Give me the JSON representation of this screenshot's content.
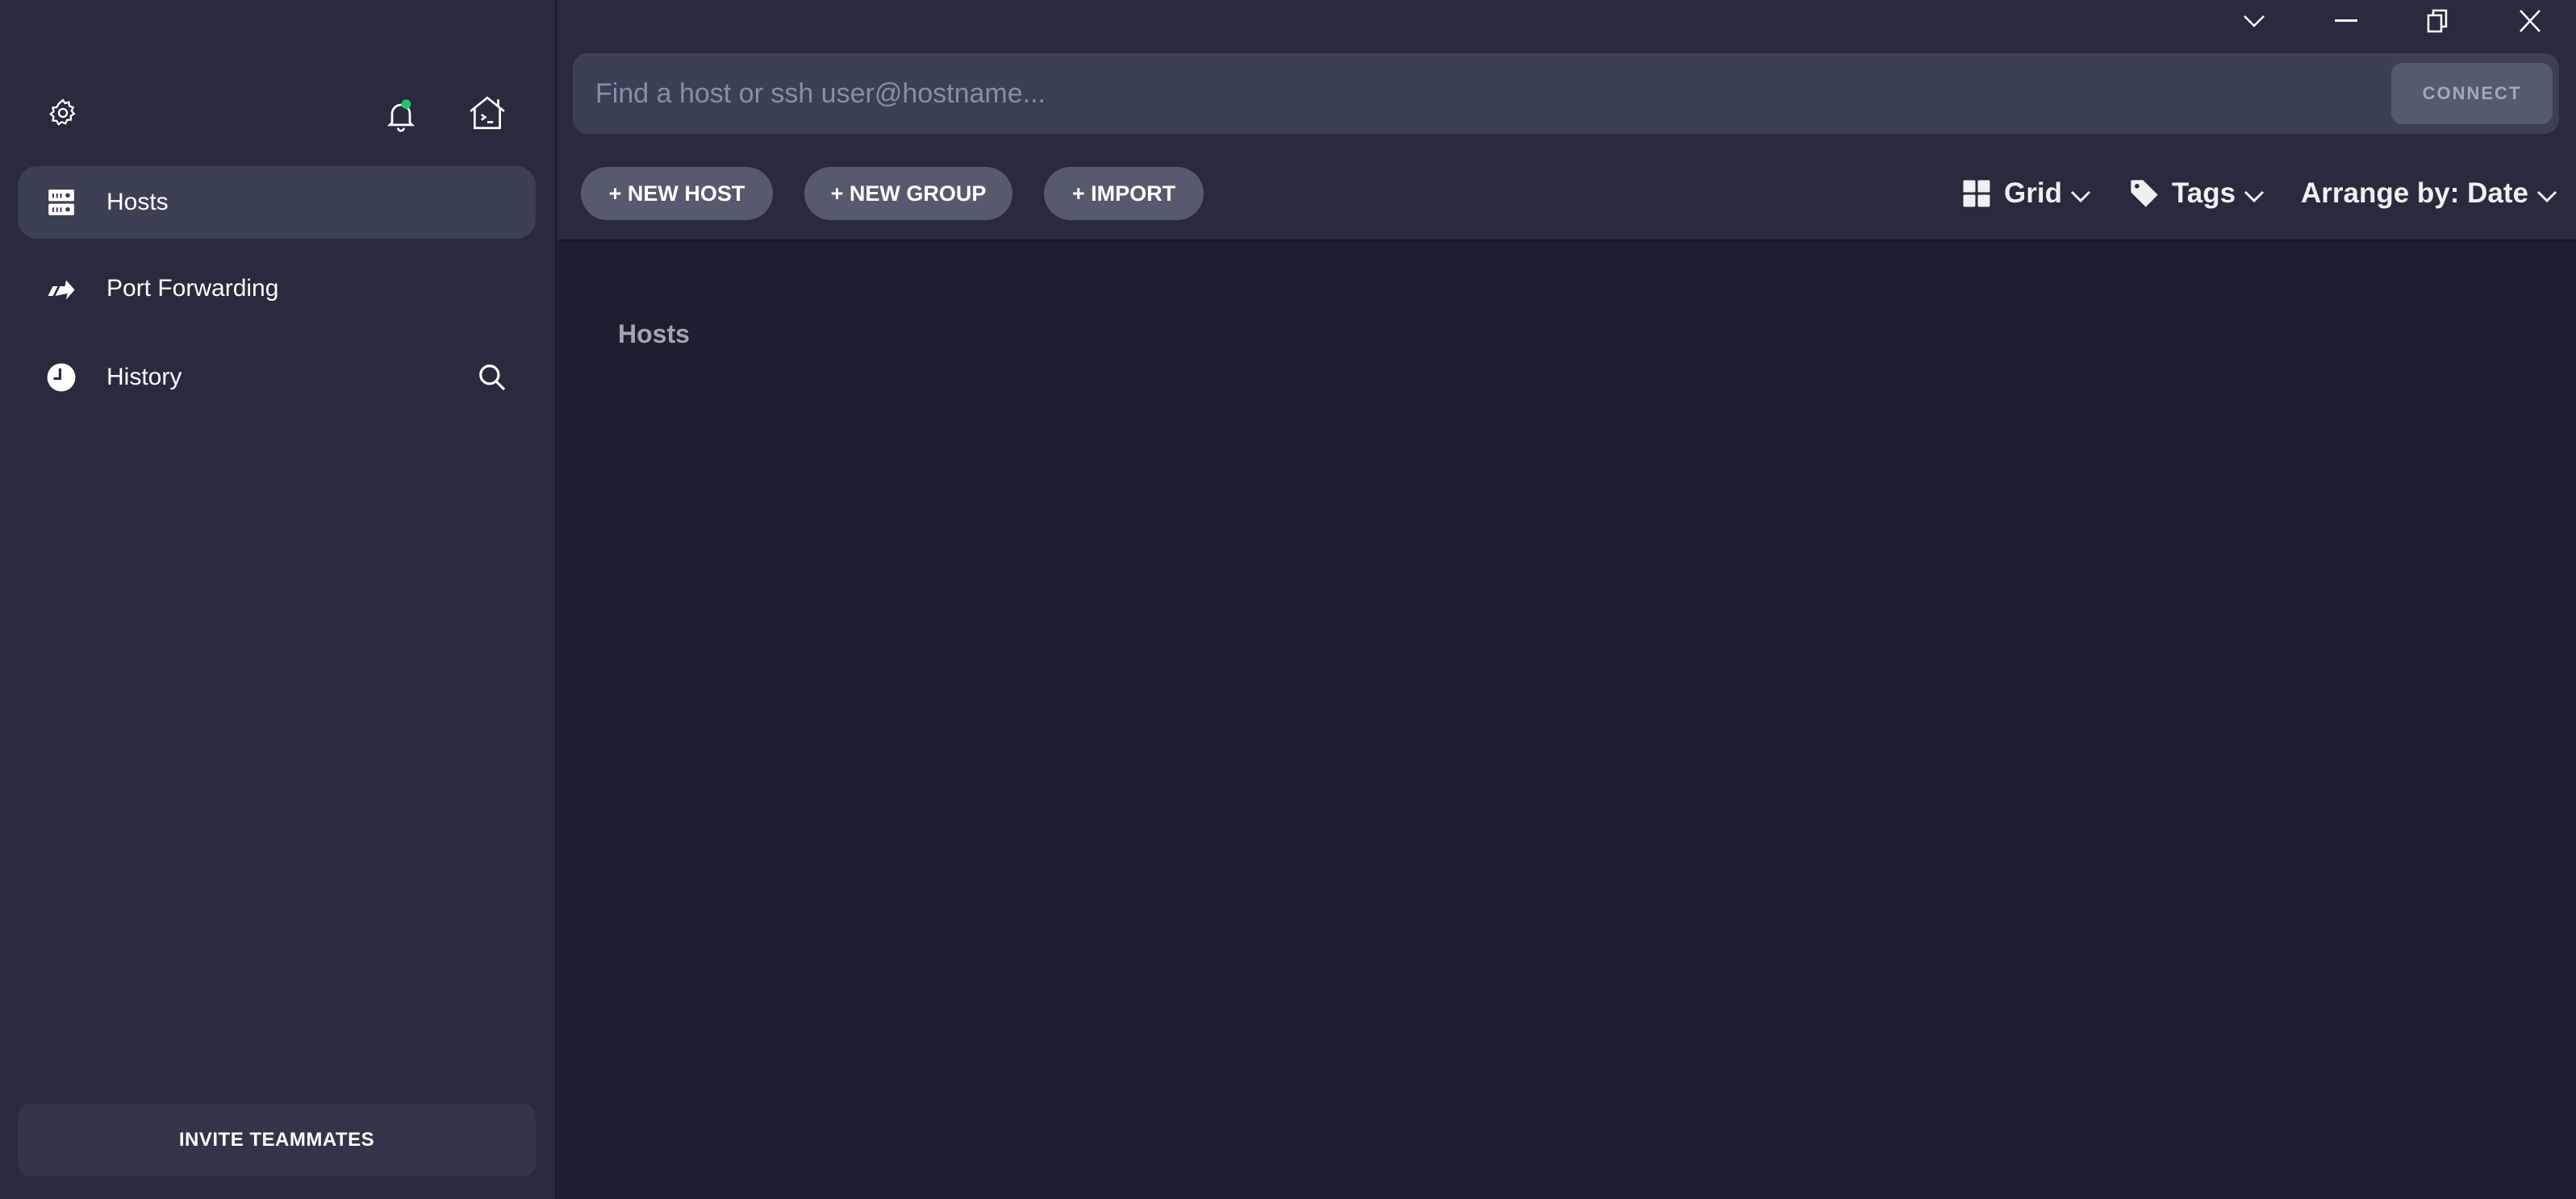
{
  "window_controls": {
    "menu_icon": "chevron-down-icon",
    "minimize_icon": "minimize-icon",
    "restore_icon": "restore-icon",
    "close_icon": "close-icon"
  },
  "sidebar": {
    "top_icons": {
      "settings": "gear-icon",
      "notifications": "bell-icon",
      "notification_dot_color": "#1fc46c",
      "local_terminal": "home-terminal-icon"
    },
    "items": [
      {
        "label": "Hosts",
        "icon": "server-icon",
        "active": true
      },
      {
        "label": "Port Forwarding",
        "icon": "port-forward-icon",
        "active": false
      },
      {
        "label": "History",
        "icon": "clock-icon",
        "active": false
      }
    ],
    "history_search_icon": "search-icon",
    "invite_label": "INVITE TEAMMATES"
  },
  "search": {
    "placeholder": "Find a host or ssh user@hostname...",
    "value": "",
    "connect_label": "CONNECT"
  },
  "toolbar": {
    "new_host_label": "+ NEW HOST",
    "new_group_label": "+ NEW GROUP",
    "import_label": "+ IMPORT",
    "view_label": "Grid",
    "tags_label": "Tags",
    "arrange_label": "Arrange by: Date"
  },
  "main": {
    "section_title": "Hosts"
  },
  "colors": {
    "sidebar_bg": "#282a3d",
    "main_bg": "#1d1f30",
    "active_item_bg": "#3c4054",
    "pill_bg": "#555a6e"
  }
}
